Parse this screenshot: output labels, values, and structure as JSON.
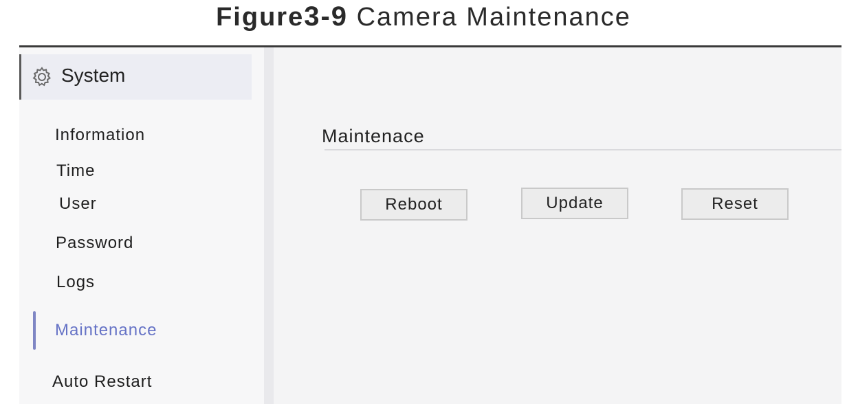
{
  "figure": {
    "label": "Figure",
    "number": "3-9",
    "caption": " Camera Maintenance"
  },
  "sidebar": {
    "header": {
      "icon": "gear-icon",
      "label": "System"
    },
    "items": [
      {
        "label": "Information"
      },
      {
        "label": "Time"
      },
      {
        "label": "User"
      },
      {
        "label": "Password"
      },
      {
        "label": "Logs"
      },
      {
        "label": "Maintenance",
        "active": true
      },
      {
        "label": "Auto Restart"
      }
    ]
  },
  "main": {
    "section_title": "Maintenace",
    "buttons": {
      "reboot": "Reboot",
      "update": "Update",
      "reset": "Reset"
    }
  },
  "colors": {
    "active_text": "#6673c6",
    "active_indicator": "#7f86c4",
    "header_background": "#ecedf3",
    "button_background": "#ececec"
  }
}
